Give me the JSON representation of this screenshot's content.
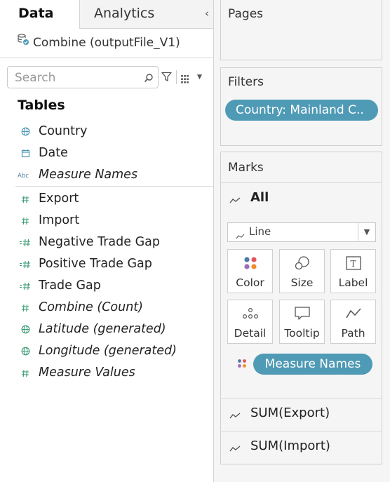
{
  "tabs": {
    "data": "Data",
    "analytics": "Analytics",
    "collapse": "‹"
  },
  "datasource": {
    "name": "Combine (outputFile_V1)"
  },
  "search": {
    "placeholder": "Search"
  },
  "tables_heading": "Tables",
  "dimensions": [
    {
      "label": "Country",
      "icon": "globe-icon",
      "italic": false
    },
    {
      "label": "Date",
      "icon": "calendar-icon",
      "italic": false
    },
    {
      "label": "Measure Names",
      "icon": "abc-icon",
      "italic": true
    }
  ],
  "measures": [
    {
      "label": "Export",
      "icon": "number-icon",
      "italic": false
    },
    {
      "label": "Import",
      "icon": "number-icon",
      "italic": false
    },
    {
      "label": "Negative Trade Gap",
      "icon": "calc-number-icon",
      "italic": false
    },
    {
      "label": "Positive Trade Gap",
      "icon": "calc-number-icon",
      "italic": false
    },
    {
      "label": "Trade Gap",
      "icon": "calc-number-icon",
      "italic": false
    },
    {
      "label": "Combine (Count)",
      "icon": "number-icon",
      "italic": true
    },
    {
      "label": "Latitude (generated)",
      "icon": "globe-icon",
      "italic": true
    },
    {
      "label": "Longitude (generated)",
      "icon": "globe-icon",
      "italic": true
    },
    {
      "label": "Measure Values",
      "icon": "number-icon",
      "italic": true
    }
  ],
  "shelves": {
    "pages": "Pages",
    "filters": "Filters",
    "filter_pill": "Country: Mainland C..",
    "marks": "Marks"
  },
  "marks": {
    "all_label": "All",
    "mark_type": "Line",
    "buttons": {
      "color": "Color",
      "size": "Size",
      "label": "Label",
      "detail": "Detail",
      "tooltip": "Tooltip",
      "path": "Path",
      "label_glyph": "T"
    },
    "measure_names_pill": "Measure Names",
    "rows": {
      "export": "SUM(Export)",
      "import": "SUM(Import)"
    }
  },
  "colors": {
    "pill": "#4f9ab5",
    "icon_green": "#3c9b74",
    "text": "#222222",
    "color_dots": [
      "#4e79a7",
      "#e15759",
      "#f28e2b",
      "#9c6fb4"
    ]
  }
}
